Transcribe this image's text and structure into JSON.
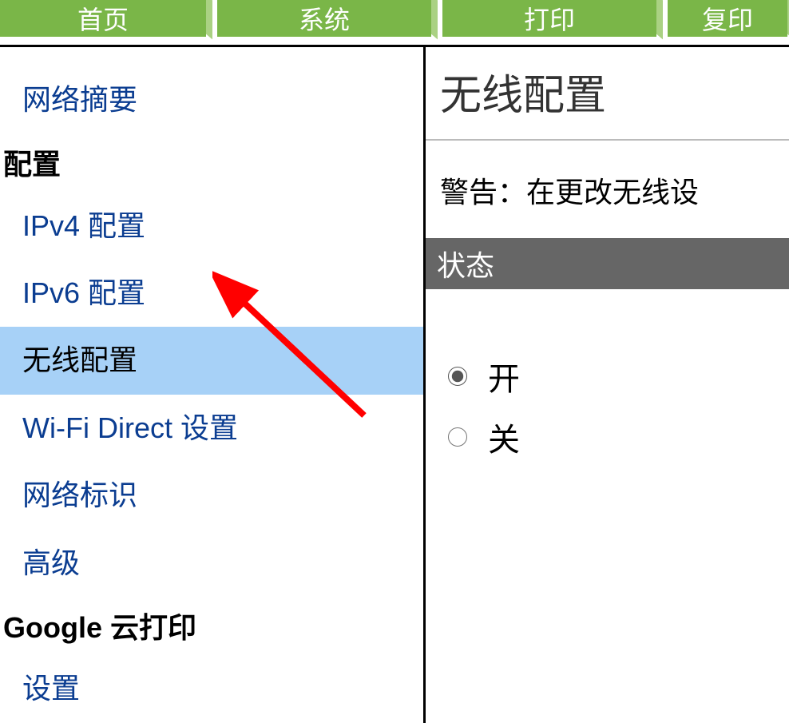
{
  "tabs": {
    "home": "首页",
    "system": "系统",
    "print": "打印",
    "copy": "复印"
  },
  "sidebar": {
    "network_summary": "网络摘要",
    "section_config": "配置",
    "ipv4": "IPv4 配置",
    "ipv6": "IPv6 配置",
    "wireless": "无线配置",
    "wifi_direct": "Wi-Fi Direct 设置",
    "network_id": "网络标识",
    "advanced": "高级",
    "section_google": "Google 云打印",
    "settings": "设置"
  },
  "main": {
    "title": "无线配置",
    "warning": "警告：在更改无线设",
    "status_label": "状态",
    "radio_on": "开",
    "radio_off": "关"
  }
}
